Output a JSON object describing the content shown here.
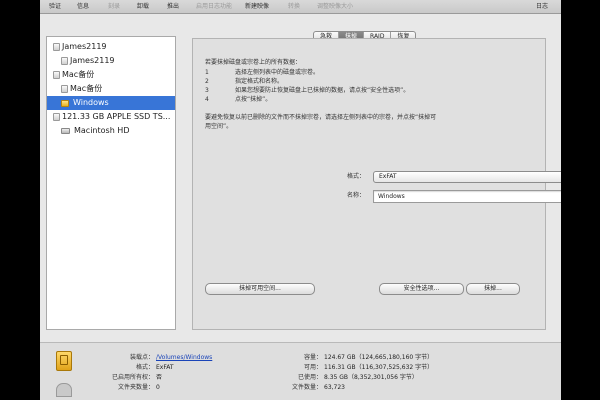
{
  "toolbar": {
    "buttons": [
      {
        "label": "验证",
        "enabled": true
      },
      {
        "label": "信息",
        "enabled": true
      },
      {
        "label": "刻录",
        "enabled": false
      },
      {
        "label": "卸载",
        "enabled": true
      },
      {
        "label": "推出",
        "enabled": true
      },
      {
        "label": "启用日志功能",
        "enabled": false
      },
      {
        "label": "新建映像",
        "enabled": true
      },
      {
        "label": "转换",
        "enabled": false
      },
      {
        "label": "调整映像大小",
        "enabled": false
      }
    ],
    "log_label": "日志"
  },
  "sidebar": {
    "items": [
      {
        "label": "James2119",
        "kind": "disk-icon"
      },
      {
        "label": "James2119",
        "kind": "volume-icon"
      },
      {
        "label": "Mac备份",
        "kind": "disk-icon"
      },
      {
        "label": "Mac备份",
        "kind": "volume-icon"
      },
      {
        "label": "Windows",
        "kind": "volume-icon",
        "selected": true
      },
      {
        "label": "121.33 GB APPLE SSD TS...",
        "kind": "disk-icon"
      },
      {
        "label": "Macintosh HD",
        "kind": "hard-drive-icon"
      }
    ]
  },
  "tabs": [
    {
      "label": "急救",
      "active": false
    },
    {
      "label": "抹掉",
      "active": true
    },
    {
      "label": "RAID",
      "active": false
    },
    {
      "label": "恢复",
      "active": false
    }
  ],
  "erase": {
    "intro": "若要抹掉磁盘或宗卷上的所有数据：",
    "steps": [
      {
        "num": "1",
        "text": "选择左侧列表中的磁盘或宗卷。"
      },
      {
        "num": "2",
        "text": "指定格式和名称。"
      },
      {
        "num": "3",
        "text": "如果您想要防止恢复磁盘上已抹掉的数据，请点按“安全性选项”。"
      },
      {
        "num": "4",
        "text": "点按“抹掉”。"
      }
    ],
    "note_line1": "要避免恢复以前已删除的文件而不抹掉宗卷，请选择左侧列表中的宗卷，并点按“抹掉可",
    "note_line2": "用空间”。",
    "format_label": "格式：",
    "format_value": "ExFAT",
    "name_label": "名称：",
    "name_value": "Windows",
    "erase_free_space_button": "抹掉可用空间...",
    "security_options_button": "安全性选项...",
    "erase_button": "抹掉..."
  },
  "info": {
    "mount_point_label": "装载点：",
    "mount_point_value": "/Volumes/Windows",
    "format_label": "格式：",
    "format_value": "ExFAT",
    "owners_enabled_label": "已启用所有权：",
    "owners_enabled_value": "否",
    "folder_count_label": "文件夹数量：",
    "folder_count_value": "0",
    "capacity_label": "容量：",
    "capacity_value": "124.67 GB（124,665,180,160 字节）",
    "available_label": "可用：",
    "available_value": "116.31 GB（116,307,525,632 字节）",
    "used_label": "已使用：",
    "used_value": "8.35 GB（8,352,301,056 字节）",
    "file_count_label": "文件数量：",
    "file_count_value": "63,723"
  }
}
